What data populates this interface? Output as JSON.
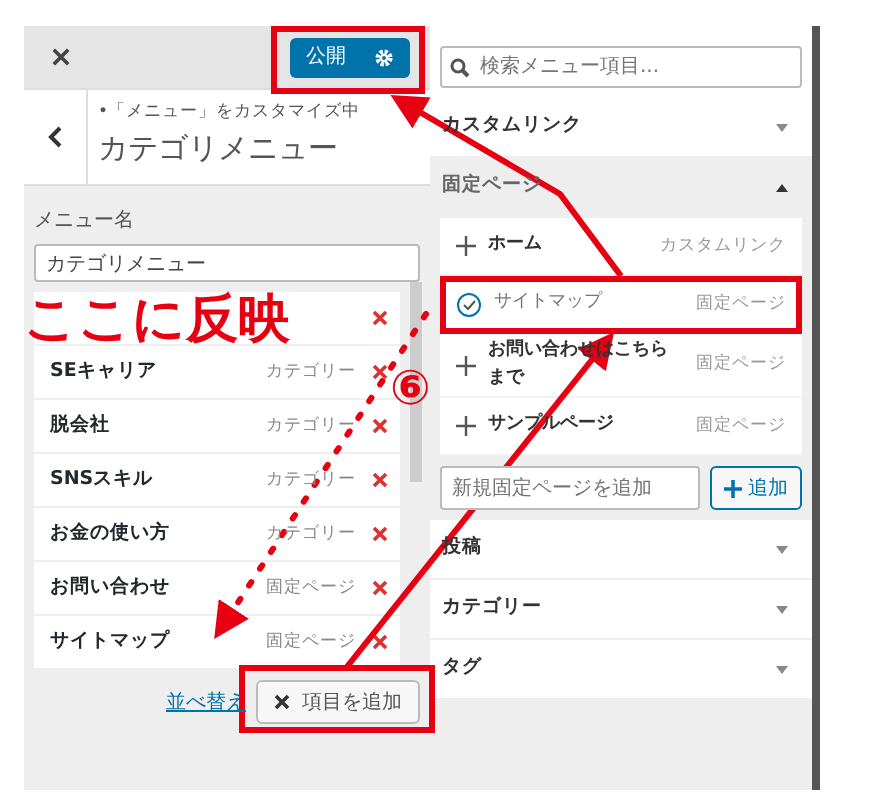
{
  "topbar": {
    "publish": "公開"
  },
  "header": {
    "breadcrumb": "•「メニュー」をカスタマイズ中",
    "title": "カテゴリメニュー"
  },
  "menu_name": {
    "label": "メニュー名",
    "value": "カテゴリメニュー"
  },
  "menu_items": [
    {
      "removable": true
    },
    {
      "title": "SEキャリア",
      "type": "カテゴリー",
      "removable": true
    },
    {
      "title": "脱会社",
      "type": "カテゴリー",
      "removable": true
    },
    {
      "title": "SNSスキル",
      "type": "カテゴリー",
      "removable": true
    },
    {
      "title": "お金の使い方",
      "type": "カテゴリー",
      "removable": true
    },
    {
      "title": "お問い合わせ",
      "type": "固定ページ",
      "removable": true
    },
    {
      "title": "サイトマップ",
      "type": "固定ページ",
      "removable": true
    }
  ],
  "footer": {
    "reorder": "並べ替え",
    "add_button": "項目を追加"
  },
  "search": {
    "placeholder": "検索メニュー項目..."
  },
  "sections": [
    {
      "title": "カスタムリンク",
      "expanded": false
    },
    {
      "title": "固定ページ",
      "expanded": true,
      "items": [
        {
          "title": "ホーム",
          "type": "カスタムリンク",
          "added": false
        },
        {
          "title": "サイトマップ",
          "type": "固定ページ",
          "added": true
        },
        {
          "title": "お問い合わせはこちらまで",
          "type": "固定ページ",
          "added": false
        },
        {
          "title": "サンプルページ",
          "type": "固定ページ",
          "added": false
        }
      ],
      "new_page": {
        "placeholder": "新規固定ページを追加"
      },
      "add_button": "追加"
    },
    {
      "title": "投稿",
      "expanded": false
    },
    {
      "title": "カテゴリー",
      "expanded": false
    },
    {
      "title": "タグ",
      "expanded": false
    }
  ],
  "annotations": {
    "caption": "ここに反映",
    "step": "⑥"
  }
}
